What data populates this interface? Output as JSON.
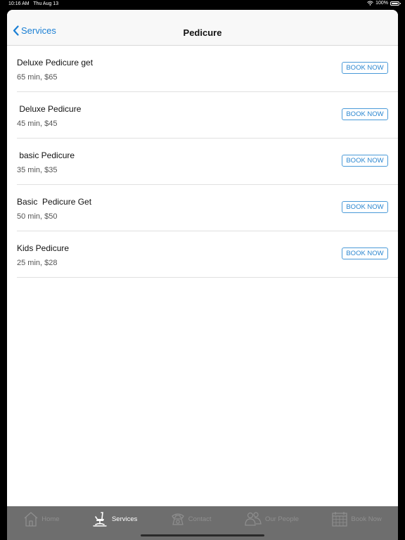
{
  "status_bar": {
    "time": "10:16 AM   Thu Aug 13",
    "battery": "100%",
    "icons": [
      "wifi-icon",
      "battery-icon"
    ]
  },
  "nav": {
    "back_label": "Services",
    "back_icon": "chevron-left-icon",
    "title": "Pedicure"
  },
  "services": [
    {
      "name": "Deluxe Pedicure get",
      "detail": "65 min, $65",
      "button": "BOOK NOW"
    },
    {
      "name": " Deluxe Pedicure",
      "detail": "45 min, $45",
      "button": "BOOK NOW"
    },
    {
      "name": " basic Pedicure",
      "detail": "35 min, $35",
      "button": "BOOK NOW"
    },
    {
      "name": "Basic  Pedicure Get",
      "detail": "50 min, $50",
      "button": "BOOK NOW"
    },
    {
      "name": "Kids Pedicure",
      "detail": "25 min, $28",
      "button": "BOOK NOW"
    }
  ],
  "tabs": [
    {
      "label": "Home",
      "icon": "house-icon",
      "active": false
    },
    {
      "label": "Services",
      "icon": "salon-chair-icon",
      "active": true
    },
    {
      "label": "Contact",
      "icon": "telephone-icon",
      "active": false
    },
    {
      "label": "Our People",
      "icon": "people-icon",
      "active": false
    },
    {
      "label": "Book Now",
      "icon": "calendar-icon",
      "active": false
    }
  ],
  "colors": {
    "accent": "#1a7fd4",
    "tab_bar": "#6e6e6e",
    "tab_active": "#ffffff",
    "tab_inactive": "#8f8f8f"
  }
}
